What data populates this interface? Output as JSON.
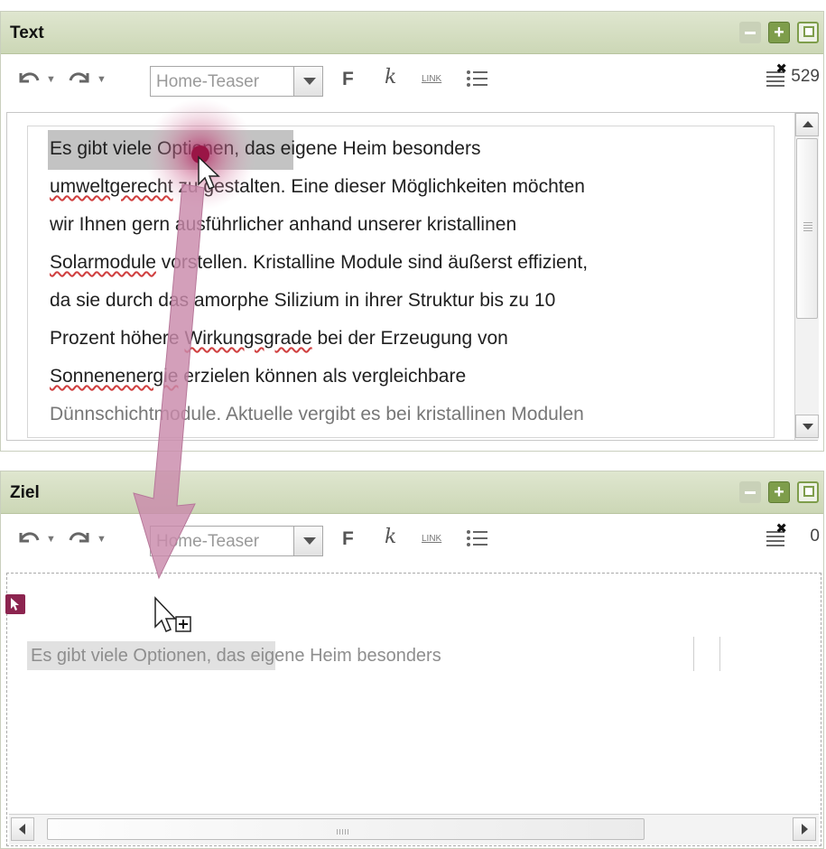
{
  "panels": {
    "text": {
      "title": "Text",
      "style_value": "Home-Teaser",
      "bold_label": "F",
      "italic_label": "k",
      "link_label": "LINK",
      "counter": "529",
      "lines": [
        [
          "Es gibt viele Optionen, das eigene Heim besonders"
        ],
        [
          "umweltgerecht zu gestalten. Eine dieser Möglichkeiten möchten"
        ],
        [
          "wir Ihnen gern ausführlicher anhand unserer kristallinen"
        ],
        [
          "Solarmodule vorstellen. Kristalline Module sind äußerst effizient,"
        ],
        [
          "da sie durch das amorphe Silizium in ihrer Struktur bis zu 10"
        ],
        [
          "Prozent höhere Wirkungsgrade bei der Erzeugung von"
        ],
        [
          "Sonnenenergie erzielen können als vergleichbare"
        ]
      ]
    },
    "target": {
      "title": "Ziel",
      "style_value": "Home-Teaser",
      "bold_label": "F",
      "italic_label": "k",
      "link_label": "LINK",
      "counter": "0",
      "drop_text_selected": "Es gibt viele Optionen",
      "drop_text_rest": ", das eigene Heim besonders"
    }
  },
  "colors": {
    "header_bg": "#d6dfc4",
    "accent_green": "#7e9d4b",
    "drag_arrow": "#c98aab",
    "drop_marker": "#8c244f"
  },
  "icons": {
    "undo": "undo-icon",
    "redo": "redo-icon",
    "list": "bullet-list-icon",
    "counter": "word-count-icon",
    "minimize": "minimize-icon",
    "maximize": "maximize-icon",
    "restore": "restore-icon"
  }
}
